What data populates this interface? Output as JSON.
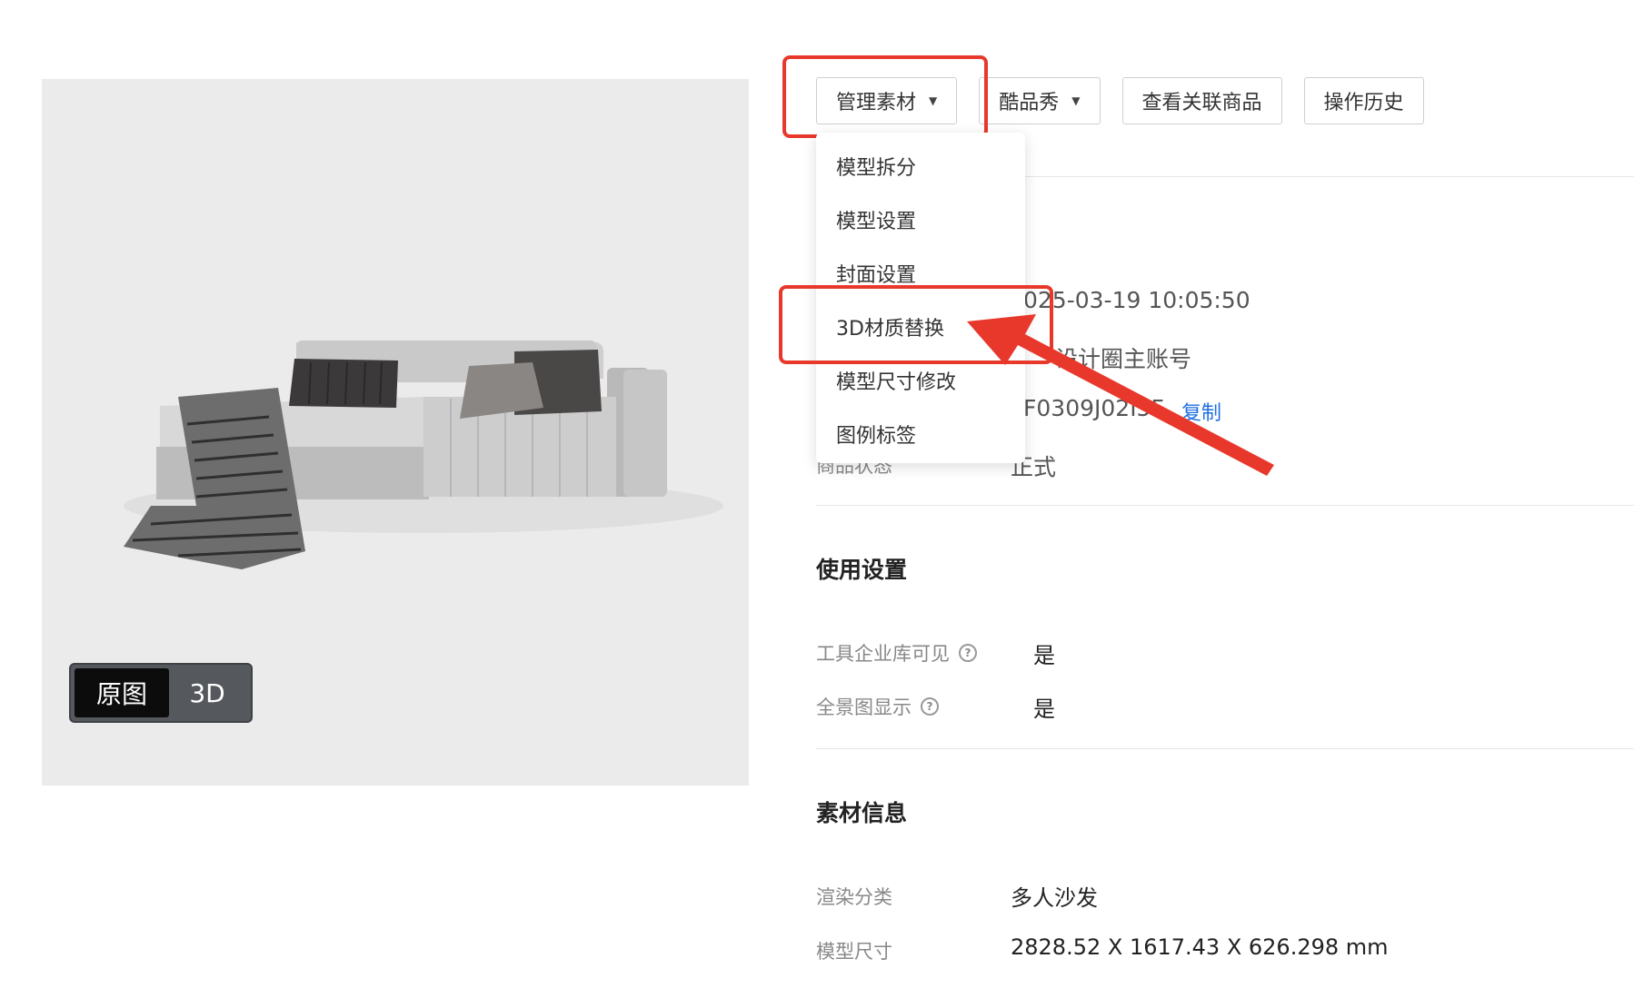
{
  "preview": {
    "toggle": {
      "original_label": "原图",
      "three_d_label": "3D",
      "active": "原图"
    }
  },
  "toolbar": {
    "manage_label": "管理素材",
    "kupin_label": "酷品秀",
    "related_label": "查看关联商品",
    "history_label": "操作历史"
  },
  "dropdown": {
    "items": [
      "模型拆分",
      "模型设置",
      "封面设置",
      "3D材质替换",
      "模型尺寸修改",
      "图例标签"
    ],
    "highlighted_item": "3D材质替换"
  },
  "basic_info": {
    "time_value": "025-03-19 10:05:50",
    "account_value": "设计圈主账号",
    "code_value": "F0309J02I5F",
    "copy_label": "复制",
    "status_label": "商品状态",
    "status_value": "正式"
  },
  "usage": {
    "title": "使用设置",
    "rows": [
      {
        "label": "工具企业库可见",
        "value": "是"
      },
      {
        "label": "全景图显示",
        "value": "是"
      }
    ]
  },
  "material": {
    "title": "素材信息",
    "rows": [
      {
        "label": "渲染分类",
        "value": "多人沙发"
      },
      {
        "label": "模型尺寸",
        "value": "2828.52 X 1617.43 X 626.298 mm"
      }
    ]
  },
  "annotation": {
    "color": "#e8382c"
  }
}
